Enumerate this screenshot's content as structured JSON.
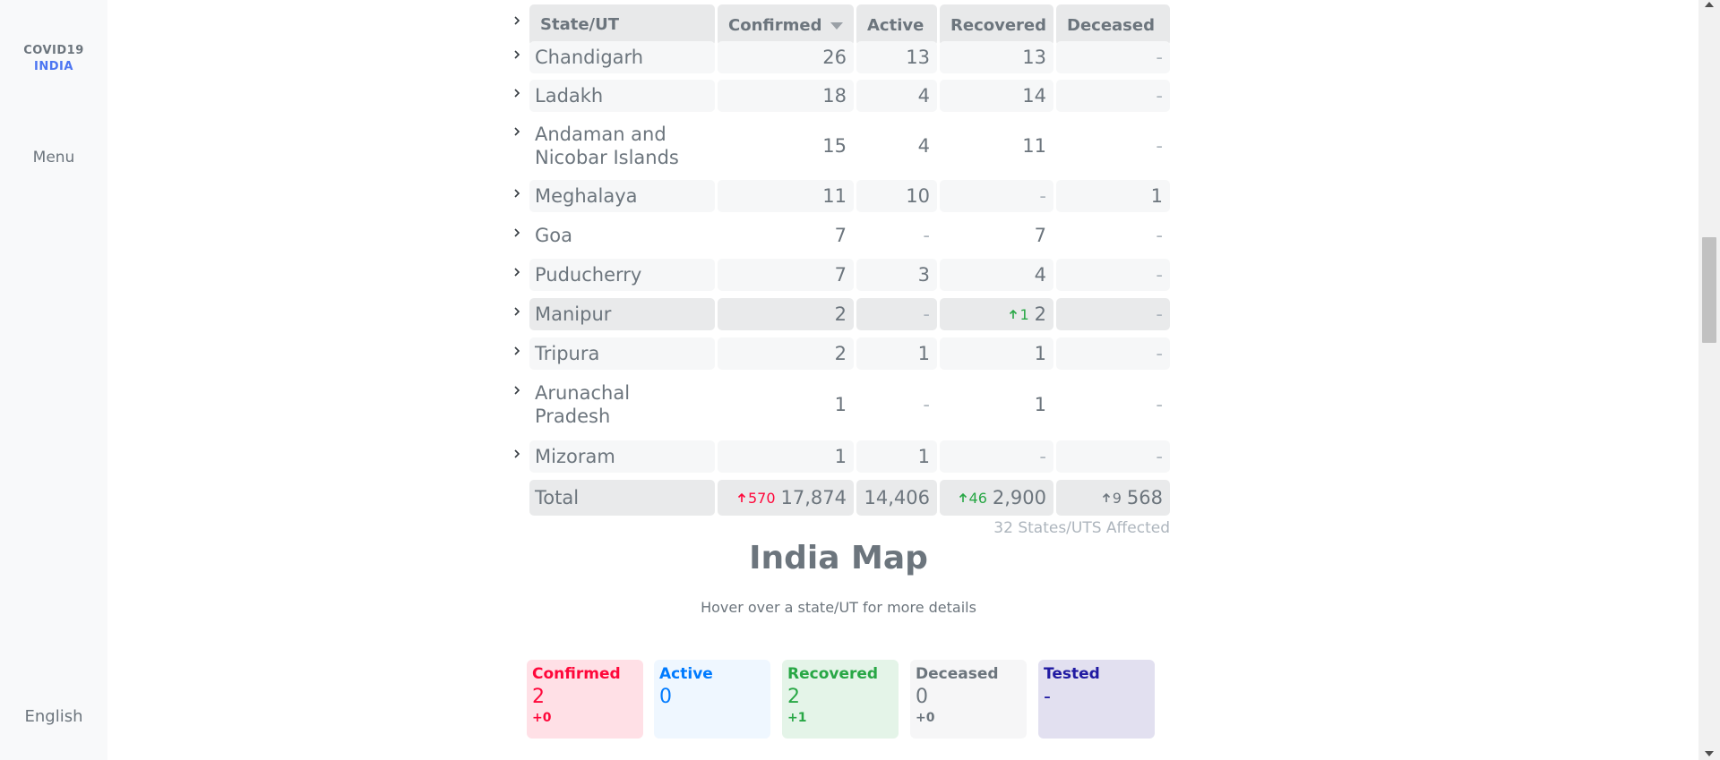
{
  "sidebar": {
    "brand_line1": "COVID19",
    "brand_line2": "INDIA",
    "menu_label": "Menu",
    "language_label": "English"
  },
  "table": {
    "headers": {
      "state": "State/UT",
      "confirmed": "Confirmed",
      "active": "Active",
      "recovered": "Recovered",
      "deceased": "Deceased"
    },
    "rows": [
      {
        "name": "Chandigarh",
        "confirmed": "26",
        "active": "13",
        "recovered": "13",
        "deceased": "-"
      },
      {
        "name": "Ladakh",
        "confirmed": "18",
        "active": "4",
        "recovered": "14",
        "deceased": "-"
      },
      {
        "name": "Andaman and Nicobar Islands",
        "confirmed": "15",
        "active": "4",
        "recovered": "11",
        "deceased": "-"
      },
      {
        "name": "Meghalaya",
        "confirmed": "11",
        "active": "10",
        "recovered": "-",
        "deceased": "1"
      },
      {
        "name": "Goa",
        "confirmed": "7",
        "active": "-",
        "recovered": "7",
        "deceased": "-"
      },
      {
        "name": "Puducherry",
        "confirmed": "7",
        "active": "3",
        "recovered": "4",
        "deceased": "-"
      },
      {
        "name": "Manipur",
        "confirmed": "2",
        "active": "-",
        "recovered": "2",
        "recovered_delta": "1",
        "deceased": "-"
      },
      {
        "name": "Tripura",
        "confirmed": "2",
        "active": "1",
        "recovered": "1",
        "deceased": "-"
      },
      {
        "name": "Arunachal Pradesh",
        "confirmed": "1",
        "active": "-",
        "recovered": "1",
        "deceased": "-"
      },
      {
        "name": "Mizoram",
        "confirmed": "1",
        "active": "1",
        "recovered": "-",
        "deceased": "-"
      }
    ],
    "total": {
      "name": "Total",
      "confirmed": "17,874",
      "confirmed_delta": "570",
      "active": "14,406",
      "recovered": "2,900",
      "recovered_delta": "46",
      "deceased": "568",
      "deceased_delta": "9"
    },
    "affected_text": "32 States/UTS Affected"
  },
  "map": {
    "title": "India Map",
    "subtitle": "Hover over a state/UT for more details",
    "cards": [
      {
        "label": "Confirmed",
        "value": "2",
        "delta": "+0",
        "color": "#ff073a",
        "bg": "#ffe0e6"
      },
      {
        "label": "Active",
        "value": "0",
        "delta": "",
        "color": "#007bff",
        "bg": "#eff7ff"
      },
      {
        "label": "Recovered",
        "value": "2",
        "delta": "+1",
        "color": "#28a745",
        "bg": "#e4f4e8"
      },
      {
        "label": "Deceased",
        "value": "0",
        "delta": "+0",
        "color": "#6c757d",
        "bg": "#f6f6f7"
      },
      {
        "label": "Tested",
        "value": "-",
        "delta": "",
        "color": "#201aa2",
        "bg": "#e2e0f0"
      }
    ]
  },
  "colors": {
    "accent_blue": "#4c75f2",
    "confirmed_red": "#ff073a",
    "recovered_green": "#28a745",
    "text_gray": "#6c757d",
    "cell_bg_light": "#f8f9fa",
    "cell_bg_dark": "#e9ecef"
  }
}
